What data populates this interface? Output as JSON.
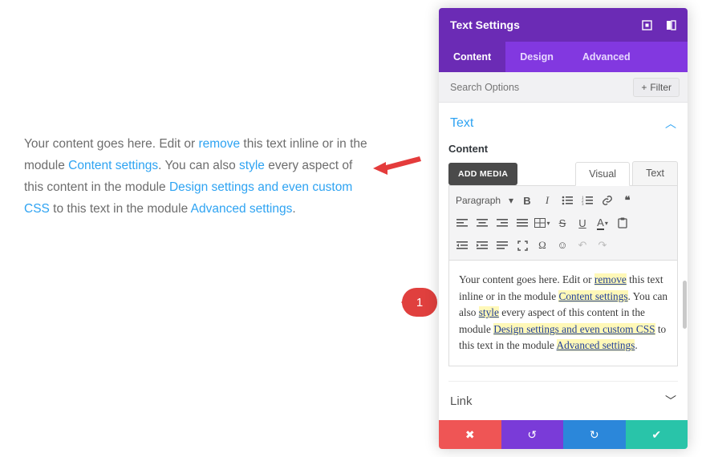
{
  "preview": {
    "parts": {
      "t1": "Your content goes here. Edit or ",
      "link_remove": "remove",
      "t2": " this text inline or in the module ",
      "link_content": "Content settings",
      "t3": ". You can also ",
      "link_style": "style",
      "t4": " every aspect of this content in the module ",
      "link_design": "Design settings and even custom CSS",
      "t5": " to this text in the module ",
      "link_advanced": "Advanced settings",
      "t6": "."
    }
  },
  "annotations": {
    "callout_1": "1"
  },
  "panel": {
    "title": "Text Settings",
    "tabs": {
      "content": "Content",
      "design": "Design",
      "advanced": "Advanced"
    },
    "search_placeholder": "Search Options",
    "filter_label": "Filter",
    "sections": {
      "text": {
        "title": "Text",
        "field_label": "Content"
      },
      "link": {
        "title": "Link"
      }
    },
    "add_media": "ADD MEDIA",
    "editor_tabs": {
      "visual": "Visual",
      "text": "Text"
    },
    "paragraph_label": "Paragraph",
    "toolbar_row1": {
      "bold": "B",
      "italic": "I",
      "ul": "≔",
      "ol": "≣",
      "link": "🔗",
      "quote": "❝"
    },
    "toolbar_row2": {
      "align_left": "≡",
      "align_center": "≡",
      "align_right": "≡",
      "align_justify": "≡",
      "table": "⊞",
      "strike": "S",
      "underline": "U",
      "textcolor": "A",
      "paste": "📋"
    },
    "toolbar_row3": {
      "outdent": "≡",
      "indent": "≡",
      "hr": "≡",
      "fullscreen": "⛶",
      "omega": "Ω",
      "emoji": "☺",
      "undo": "↶",
      "redo": "↷"
    },
    "editor_content": {
      "t1": "Your content goes here. Edit or ",
      "hl_remove": "remove",
      "t2": " this text inline or in the module ",
      "hl_content": "Content settings",
      "t3": ". You can also ",
      "hl_style": "style",
      "t4": " every aspect of this content in the module ",
      "hl_design": "Design settings and even custom CSS",
      "t5": " to this text in the module ",
      "hl_advanced": "Advanced settings",
      "t6": "."
    },
    "footer": {
      "cancel": "✖",
      "undo": "↺",
      "redo": "↻",
      "save": "✔"
    }
  }
}
